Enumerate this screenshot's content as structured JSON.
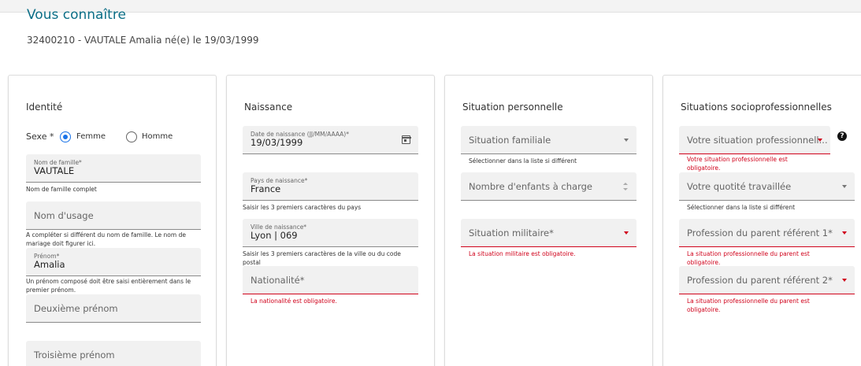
{
  "header": {
    "title": "Vous connaître",
    "student_line": "32400210 - VAUTALE Amalia né(e) le 19/03/1999"
  },
  "identite": {
    "title": "Identité",
    "sexe_label": "Sexe *",
    "options": [
      "Femme",
      "Homme"
    ],
    "selected": "Femme",
    "nom_famille": {
      "label": "Nom de famille*",
      "value": "VAUTALE",
      "hint": "Nom de famille complet"
    },
    "nom_usage": {
      "placeholder": "Nom d'usage",
      "hint": "A compléter si différent du nom de famille. Le nom de mariage doit figurer ici."
    },
    "prenom": {
      "label": "Prénom*",
      "value": "Amalia",
      "hint": "Un prénom composé doit être saisi entièrement dans le premier prénom."
    },
    "deuxieme_prenom": {
      "placeholder": "Deuxième prénom"
    },
    "troisieme_prenom": {
      "placeholder": "Troisième prénom"
    }
  },
  "naissance": {
    "title": "Naissance",
    "date": {
      "label": "Date de naissance (JJ/MM/AAAA)*",
      "value": "19/03/1999"
    },
    "pays": {
      "label": "Pays de naissance*",
      "value": "France",
      "hint": "Saisir les 3 premiers caractères du pays"
    },
    "ville": {
      "label": "Ville de naissance*",
      "value": "Lyon | 069",
      "hint": "Saisir les 3 premiers caractères de la ville ou du code postal"
    },
    "nationalite": {
      "placeholder": "Nationalité*",
      "error": "La nationalité est obligatoire."
    }
  },
  "situation_personnelle": {
    "title": "Situation personnelle",
    "familiale": {
      "placeholder": "Situation familiale",
      "hint": "Sélectionner dans la liste si différent"
    },
    "enfants": {
      "placeholder": "Nombre d'enfants à charge"
    },
    "militaire": {
      "placeholder": "Situation militaire*",
      "error": "La situation militaire est obligatoire."
    }
  },
  "socioprofessionnelles": {
    "title": "Situations socioprofessionnelles",
    "pro": {
      "placeholder": "Votre situation professionnell...",
      "error": "Votre situation professionnelle est obligatoire."
    },
    "quotite": {
      "placeholder": "Votre quotité travaillée",
      "hint": "Sélectionner dans la liste si différent"
    },
    "parent1": {
      "placeholder": "Profession du parent référent 1*",
      "error": "La situation professionnelle du parent est obligatoire."
    },
    "parent2": {
      "placeholder": "Profession du parent référent 2*",
      "error": "La situation professionnelle du parent est obligatoire."
    },
    "help_icon": "?"
  },
  "colors": {
    "accent": "#0b6e86",
    "error": "#d0021b",
    "radio": "#1a73e8"
  }
}
